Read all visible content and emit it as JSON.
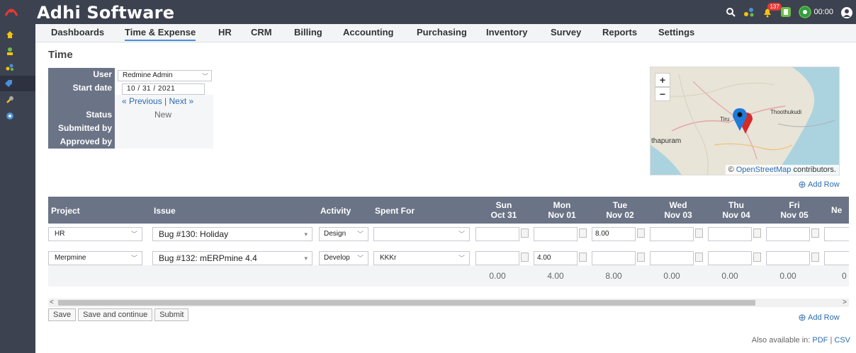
{
  "app": {
    "title": "Adhi Software"
  },
  "topbar": {
    "notification_count": "137",
    "timer": "00:00",
    "icons": [
      "search-icon",
      "network-icon",
      "bell-icon",
      "clipboard-icon",
      "timer-icon",
      "user-icon"
    ]
  },
  "sidebar": {
    "icons": [
      "home-icon",
      "user-icon",
      "people-icon",
      "tag-icon",
      "wrench-icon",
      "help-icon"
    ]
  },
  "menu": [
    "Dashboards",
    "Time & Expense",
    "HR",
    "CRM",
    "Billing",
    "Accounting",
    "Purchasing",
    "Inventory",
    "Survey",
    "Reports",
    "Settings"
  ],
  "page": {
    "title": "Time"
  },
  "info": {
    "user_label": "User",
    "user_value": "Redmine Admin",
    "start_label": "Start date",
    "start_value": "10 / 31 / 2021",
    "nav_prev": "« Previous",
    "nav_sep": " | ",
    "nav_next": "Next »",
    "status_label": "Status",
    "status_value": "New",
    "submitted_label": "Submitted by",
    "approved_label": "Approved by"
  },
  "map": {
    "zoom_in": "+",
    "zoom_out": "−",
    "labels": [
      "Thoothukudi",
      "Tiru",
      "thapuram"
    ],
    "attribution_prefix": "© ",
    "attribution_link": "OpenStreetMap",
    "attribution_suffix": " contributors."
  },
  "add_row": "Add Row",
  "grid": {
    "headers": {
      "project": "Project",
      "issue": "Issue",
      "activity": "Activity",
      "spent_for": "Spent For"
    },
    "days": [
      {
        "day": "Sun",
        "date": "Oct 31"
      },
      {
        "day": "Mon",
        "date": "Nov 01"
      },
      {
        "day": "Tue",
        "date": "Nov 02"
      },
      {
        "day": "Wed",
        "date": "Nov 03"
      },
      {
        "day": "Thu",
        "date": "Nov 04"
      },
      {
        "day": "Fri",
        "date": "Nov 05"
      },
      {
        "day": "Ne",
        "date": ""
      }
    ],
    "rows": [
      {
        "project": "HR",
        "issue": "Bug #130: Holiday",
        "activity": "Design",
        "spent_for": "",
        "hours": [
          "",
          "",
          "8.00",
          "",
          "",
          "",
          ""
        ]
      },
      {
        "project": "Merpmine",
        "issue": "Bug #132: mERPmine 4.4",
        "activity": "Develop",
        "spent_for": "KKKr",
        "hours": [
          "",
          "4.00",
          "",
          "",
          "",
          "",
          ""
        ]
      }
    ],
    "totals": [
      "0.00",
      "4.00",
      "8.00",
      "0.00",
      "0.00",
      "0.00",
      "0"
    ]
  },
  "buttons": {
    "save": "Save",
    "save_continue": "Save and continue",
    "submit": "Submit"
  },
  "formats": {
    "prefix": "Also available in: ",
    "pdf": "PDF",
    "sep": " | ",
    "csv": "CSV"
  }
}
